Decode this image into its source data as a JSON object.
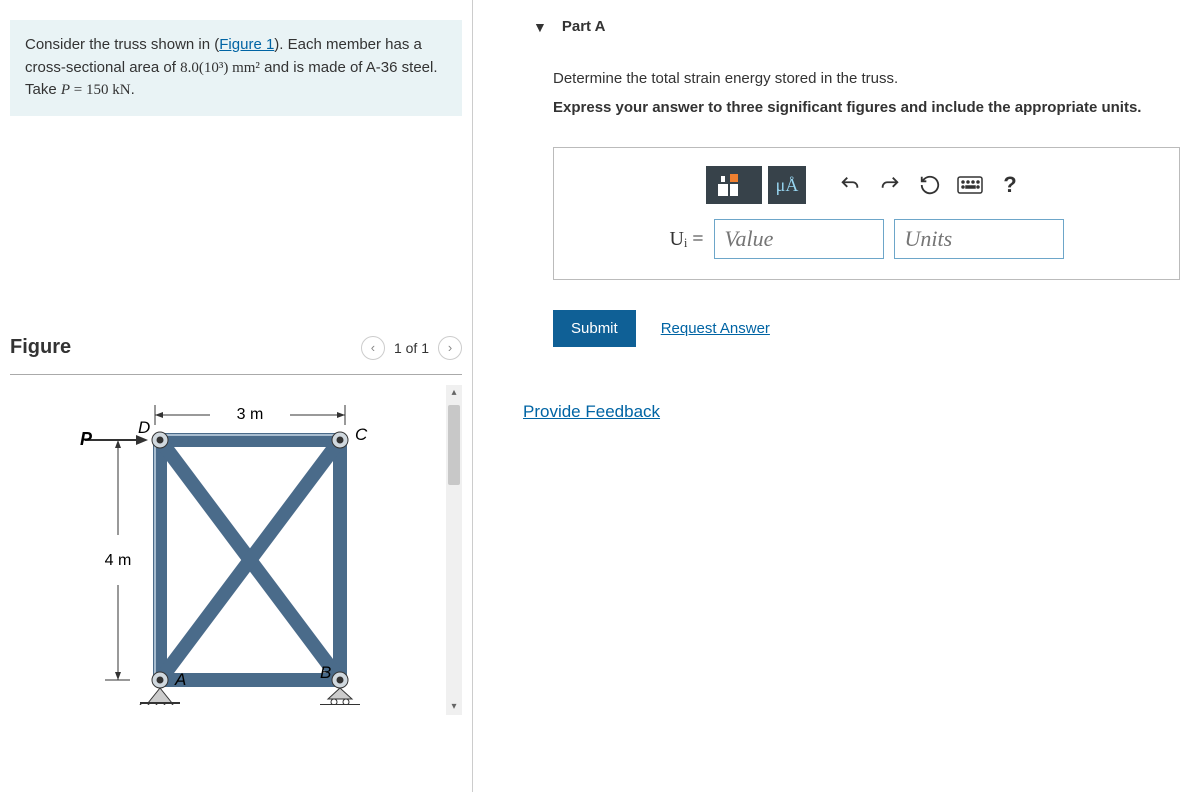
{
  "problem": {
    "pre_text": "Consider the truss shown in (",
    "figure_link": "Figure 1",
    "post_text": "). Each member has a cross-sectional area of ",
    "area_value": "8.0(10³) mm²",
    "mid_text": " and is made of A-36 steel. Take ",
    "P_symbol": "P",
    "P_value": " = 150 kN",
    "end_text": "."
  },
  "figure": {
    "heading": "Figure",
    "pager": "1 of 1",
    "labels": {
      "top_dim": "3 m",
      "left_dim": "4 m",
      "P": "P",
      "A": "A",
      "B": "B",
      "C": "C",
      "D": "D"
    }
  },
  "part": {
    "title": "Part A",
    "prompt": "Determine the total strain energy stored in the truss.",
    "instruction": "Express your answer to three significant figures and include the appropriate units.",
    "unit_btn_label": "μÅ",
    "help_label": "?",
    "answer_symbol": "Uᵢ =",
    "value_placeholder": "Value",
    "units_placeholder": "Units",
    "submit": "Submit",
    "request_answer": "Request Answer"
  },
  "feedback_link": "Provide Feedback"
}
